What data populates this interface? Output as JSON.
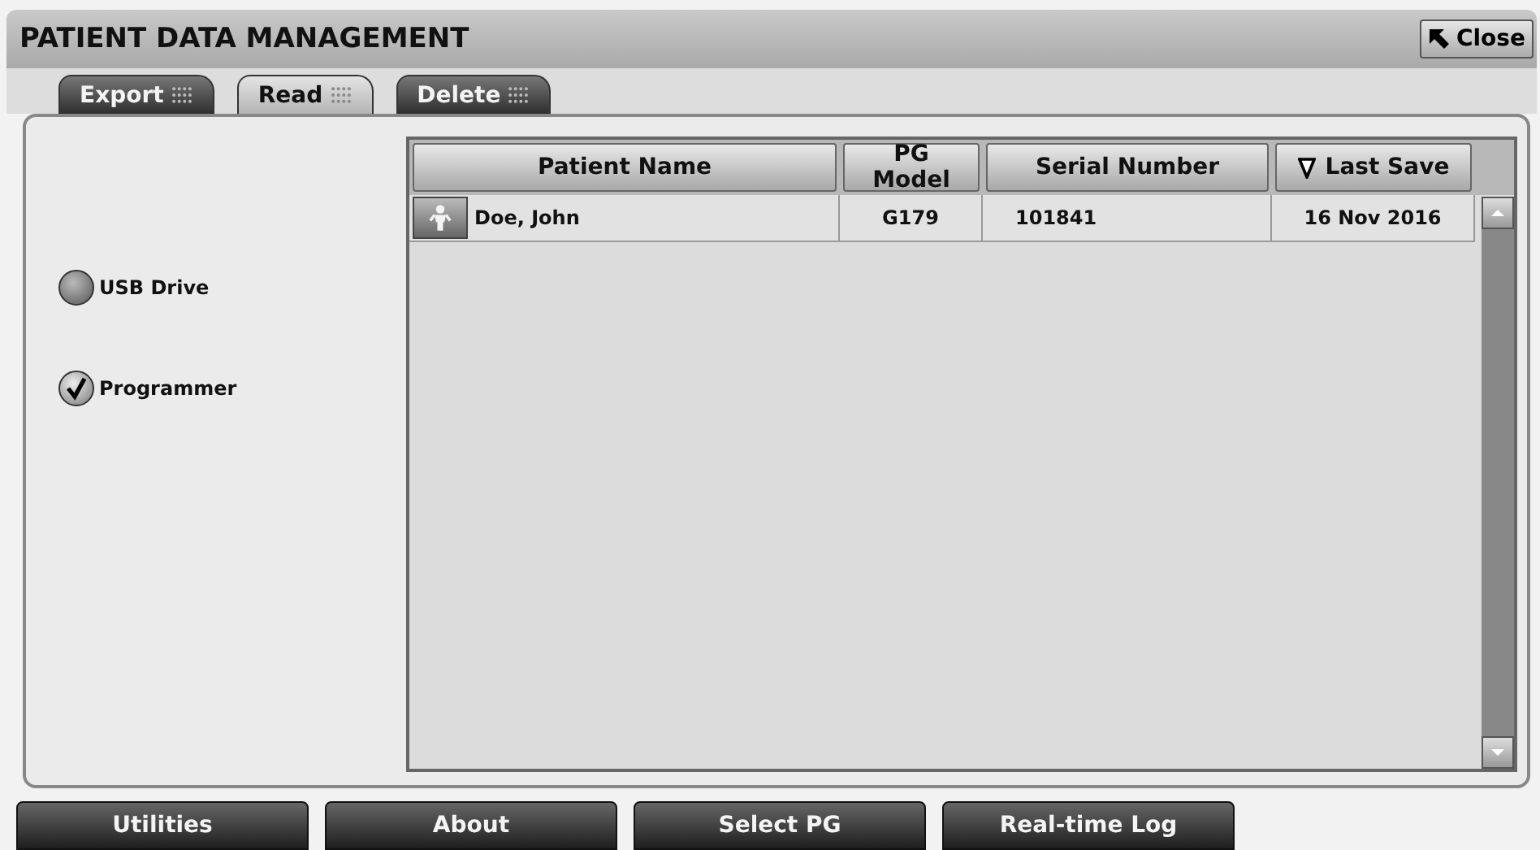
{
  "window": {
    "title": "PATIENT DATA MANAGEMENT",
    "close_label": "Close"
  },
  "tabs": [
    {
      "label": "Export",
      "selected": false
    },
    {
      "label": "Read",
      "selected": true
    },
    {
      "label": "Delete",
      "selected": false
    }
  ],
  "sources": [
    {
      "label": "USB Drive",
      "checked": false
    },
    {
      "label": "Programmer",
      "checked": true
    }
  ],
  "table": {
    "columns": [
      {
        "label": "Patient Name",
        "sorted": false
      },
      {
        "label": "PG Model",
        "sorted": false
      },
      {
        "label": "Serial Number",
        "sorted": false
      },
      {
        "label": "Last Save",
        "sorted": true
      }
    ],
    "rows": [
      {
        "patient_name": "Doe, John",
        "pg_model": "G179",
        "serial_number": "101841",
        "last_save": "16 Nov 2016"
      }
    ]
  },
  "bottom_buttons": [
    "Utilities",
    "About",
    "Select PG",
    "Real-time Log"
  ]
}
